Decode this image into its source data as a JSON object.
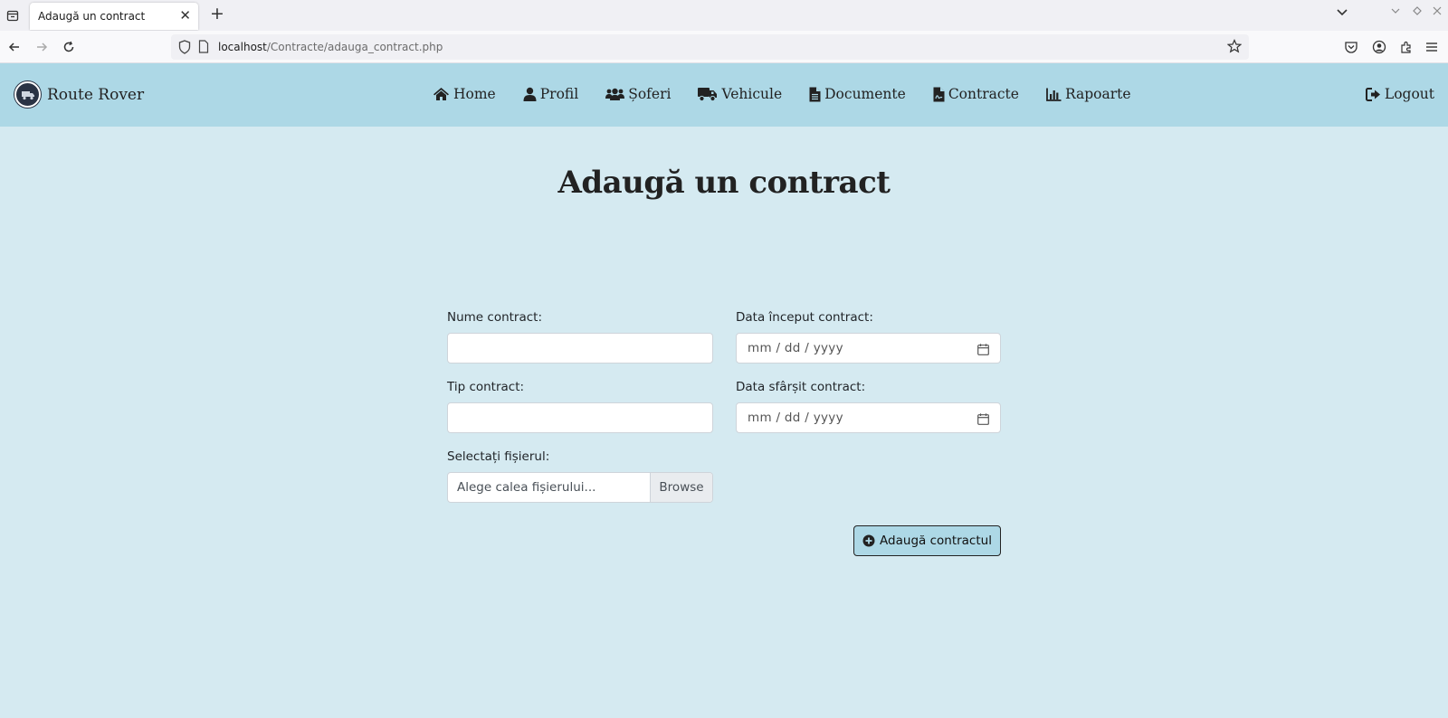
{
  "browser": {
    "tab_title": "Adaugă un contract",
    "url_host": "localhost",
    "url_path": "/Contracte/adauga_contract.php"
  },
  "site": {
    "brand": "Route Rover",
    "menu": [
      {
        "label": "Home",
        "icon": "home-icon"
      },
      {
        "label": "Profil",
        "icon": "user-icon"
      },
      {
        "label": "Șoferi",
        "icon": "users-icon"
      },
      {
        "label": "Vehicule",
        "icon": "truck-icon"
      },
      {
        "label": "Documente",
        "icon": "file-icon"
      },
      {
        "label": "Contracte",
        "icon": "contract-icon"
      },
      {
        "label": "Rapoarte",
        "icon": "chart-icon"
      }
    ],
    "logout": "Logout"
  },
  "page": {
    "title": "Adaugă un contract"
  },
  "form": {
    "name_label": "Nume contract:",
    "name_value": "",
    "start_label": "Data început contract:",
    "start_placeholder": "mm / dd / yyyy",
    "type_label": "Tip contract:",
    "type_value": "",
    "end_label": "Data sfârșit contract:",
    "end_placeholder": "mm / dd / yyyy",
    "file_label": "Selectați fișierul:",
    "file_placeholder": "Alege calea fișierului...",
    "browse_label": "Browse",
    "submit_label": "Adaugă contractul"
  },
  "colors": {
    "nav_bg": "#add8e6",
    "page_bg": "#d5eaf1"
  }
}
